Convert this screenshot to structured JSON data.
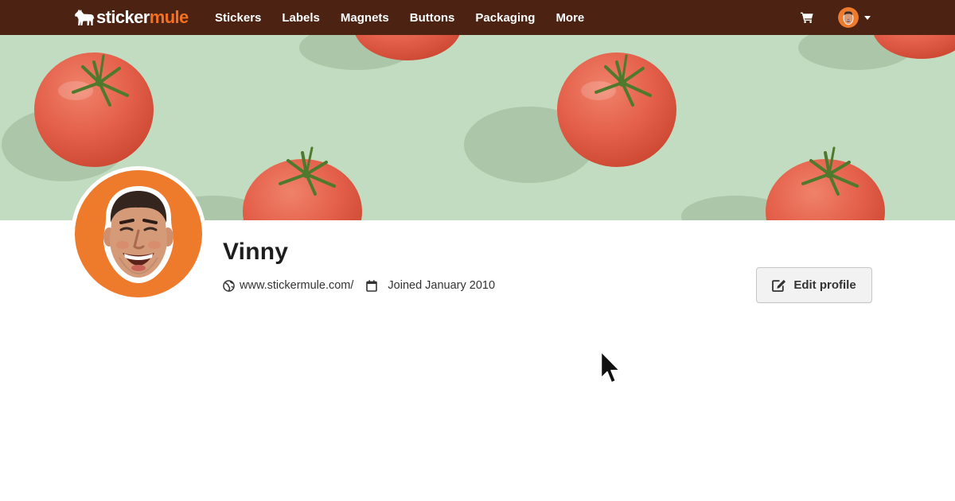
{
  "brand": {
    "name_part1": "sticker",
    "name_part2": "mule",
    "colors": {
      "nav_bg": "#4c2313",
      "accent": "#f37021",
      "banner_bg": "#c2dcc1"
    }
  },
  "nav": {
    "items": [
      {
        "label": "Stickers"
      },
      {
        "label": "Labels"
      },
      {
        "label": "Magnets"
      },
      {
        "label": "Buttons"
      },
      {
        "label": "Packaging"
      },
      {
        "label": "More"
      }
    ],
    "cart_icon": "shopping-cart-icon",
    "user_menu_icon": "chevron-down-icon"
  },
  "profile": {
    "name": "Vinny",
    "website": "www.stickermule.com/",
    "joined": "Joined January 2010",
    "website_icon": "globe-icon",
    "joined_icon": "calendar-icon"
  },
  "actions": {
    "edit_profile_label": "Edit profile",
    "edit_icon": "edit-icon"
  }
}
